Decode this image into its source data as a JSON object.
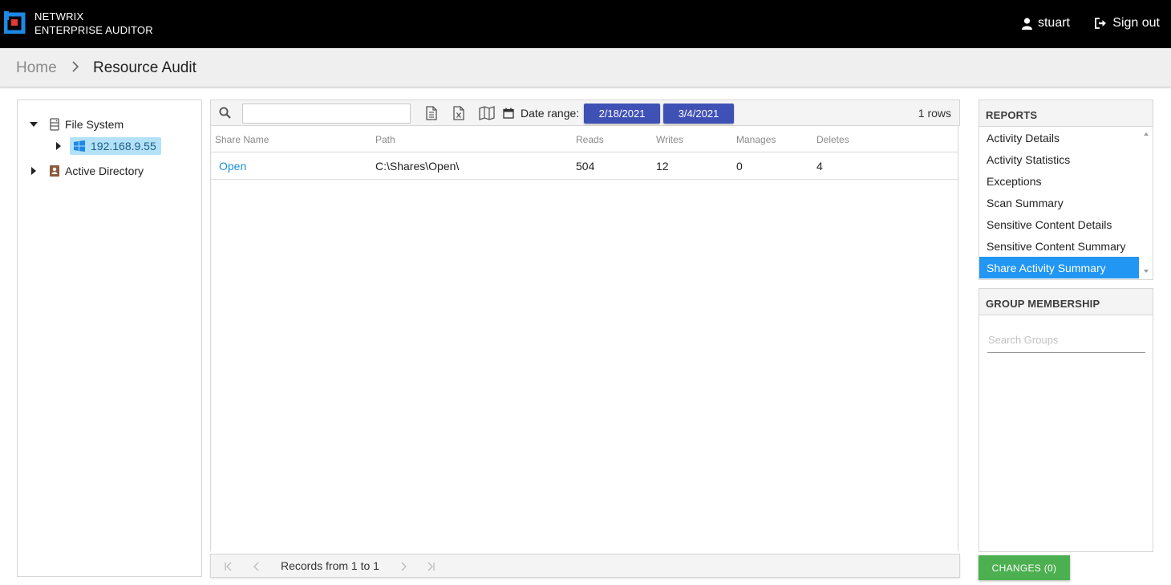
{
  "header": {
    "brand_line1": "NETWRIX",
    "brand_line2": "ENTERPRISE AUDITOR",
    "user_name": "stuart",
    "signout_label": "Sign out",
    "logo_color": "#1e88e5",
    "logo_accent": "#e53935"
  },
  "breadcrumb": {
    "home": "Home",
    "current": "Resource Audit"
  },
  "tree": {
    "file_system": {
      "label": "File System",
      "icon": "server-icon",
      "expanded": true
    },
    "host": {
      "label": "192.168.9.55",
      "icon": "windows-icon",
      "selected": true
    },
    "active_directory": {
      "label": "Active Directory",
      "icon": "directory-book-icon",
      "expanded": false
    }
  },
  "toolbar": {
    "search_value": "",
    "date_range_label": "Date range:",
    "start_date": "2/18/2021",
    "end_date": "3/4/2021",
    "row_count": "1 rows",
    "icons": [
      "search-icon",
      "document-icon",
      "excel-icon",
      "map-icon",
      "calendar-icon"
    ]
  },
  "grid": {
    "columns": [
      "Share Name",
      "Path",
      "Reads",
      "Writes",
      "Manages",
      "Deletes"
    ],
    "rows": [
      {
        "share_name": "Open",
        "path": "C:\\Shares\\Open\\",
        "reads": "504",
        "writes": "12",
        "manages": "0",
        "deletes": "4"
      }
    ]
  },
  "pager": {
    "text": "Records from 1 to 1"
  },
  "reports": {
    "title": "REPORTS",
    "items": [
      "Activity Details",
      "Activity Statistics",
      "Exceptions",
      "Scan Summary",
      "Sensitive Content Details",
      "Sensitive Content Summary",
      "Share Activity Summary"
    ],
    "selected_index": 6
  },
  "groups": {
    "title": "GROUP MEMBERSHIP",
    "search_placeholder": "Search Groups",
    "search_value": ""
  },
  "changes_button": "CHANGES (0)",
  "colors": {
    "accent_blue": "#2196f3",
    "date_button": "#3f51b5",
    "changes_green": "#4caf50",
    "link": "#1a8fd6",
    "selected_tree": "#b3e1f7"
  }
}
